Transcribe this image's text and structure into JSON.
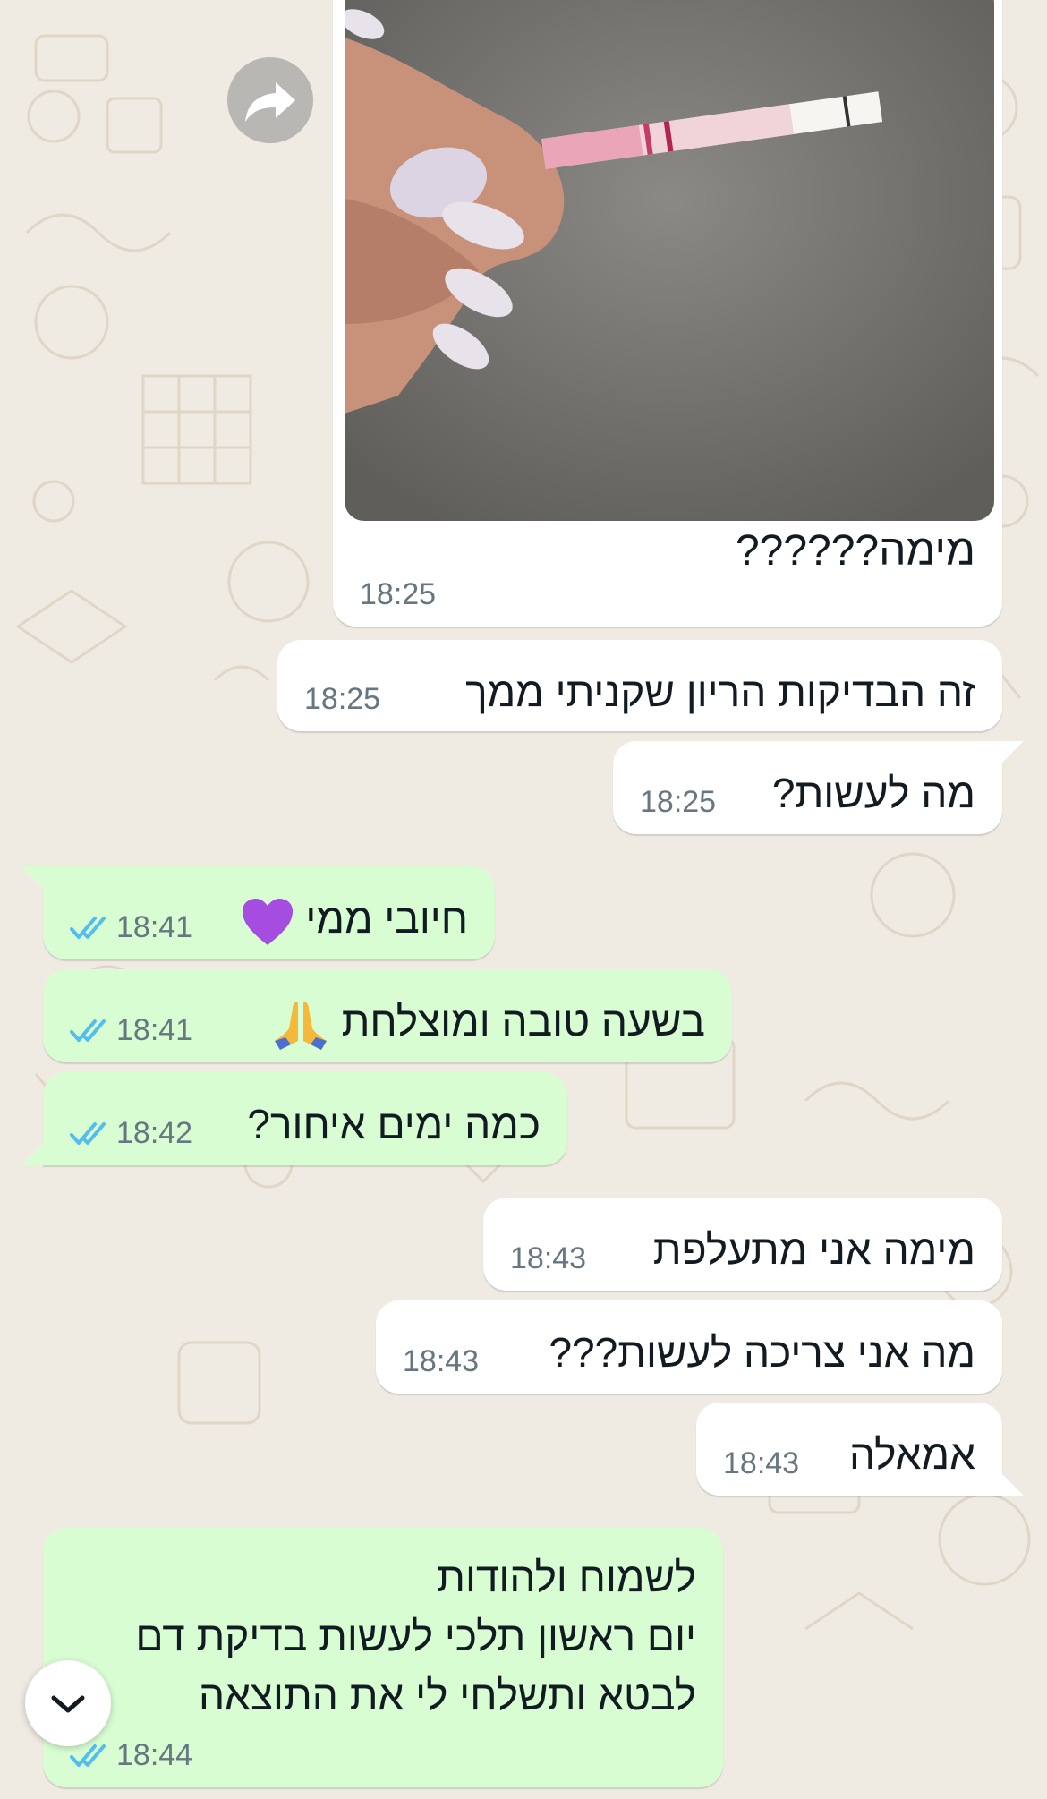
{
  "chat": {
    "photo_message": {
      "caption": "מימה??????",
      "time": "18:25"
    },
    "messages": [
      {
        "direction": "incoming",
        "text": "זה הבדיקות הריון שקניתי ממך",
        "time": "18:25"
      },
      {
        "direction": "incoming",
        "text": "מה לעשות?",
        "time": "18:25"
      },
      {
        "direction": "outgoing",
        "text": "חיובי ממי",
        "emoji": "purple-heart",
        "time": "18:41",
        "status": "read"
      },
      {
        "direction": "outgoing",
        "text": "בשעה טובה ומוצלחת",
        "emoji": "folded-hands",
        "time": "18:41",
        "status": "read"
      },
      {
        "direction": "outgoing",
        "text": "כמה ימים איחור?",
        "time": "18:42",
        "status": "read"
      },
      {
        "direction": "incoming",
        "text": "מימה אני מתעלפת",
        "time": "18:43"
      },
      {
        "direction": "incoming",
        "text": "מה אני צריכה לעשות???",
        "time": "18:43"
      },
      {
        "direction": "incoming",
        "text": "אמאלה",
        "time": "18:43"
      },
      {
        "direction": "outgoing",
        "text": "לשמוח ולהודות\nיום ראשון תלכי לעשות בדיקת דם\nלבטא ותשלחי לי את התוצאה",
        "time": "18:44",
        "status": "read"
      }
    ]
  },
  "controls": {
    "forward_icon": "forward-arrow-icon",
    "scroll_icon": "chevron-down-icon"
  },
  "colors": {
    "wallpaper": "#efeae2",
    "incoming_bubble": "#ffffff",
    "outgoing_bubble": "#d9fdd3",
    "read_ticks": "#53bdeb",
    "timestamp": "#667781"
  }
}
